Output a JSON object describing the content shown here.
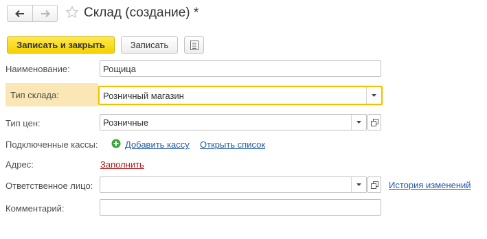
{
  "header": {
    "title": "Склад (создание) *"
  },
  "toolbar": {
    "save_close_label": "Записать и закрыть",
    "save_label": "Записать"
  },
  "form": {
    "name": {
      "label": "Наименование:",
      "value": "Рощица"
    },
    "warehouse_type": {
      "label": "Тип склада:",
      "value": "Розничный магазин"
    },
    "price_type": {
      "label": "Тип цен:",
      "value": "Розничные"
    },
    "registers": {
      "label": "Подключенные кассы:",
      "add_link": "Добавить кассу",
      "open_link": "Открыть список"
    },
    "address": {
      "label": "Адрес:",
      "fill_link": "Заполнить"
    },
    "responsible": {
      "label": "Ответственное лицо:",
      "value": "",
      "history_link": "История изменений"
    },
    "comment": {
      "label": "Комментарий:",
      "value": ""
    }
  },
  "colors": {
    "primary_button": "#f5d200",
    "highlight_row": "#fbe7b6",
    "link": "#1f5aa6",
    "link_red": "#b01c1c",
    "add_icon": "#3aa53a"
  },
  "icons": {
    "back": "arrow-left-icon",
    "forward": "arrow-right-icon",
    "favorite": "star-icon",
    "more": "document-list-icon",
    "dropdown": "chevron-down-icon",
    "open": "open-window-icon",
    "add": "plus-circle-icon"
  }
}
